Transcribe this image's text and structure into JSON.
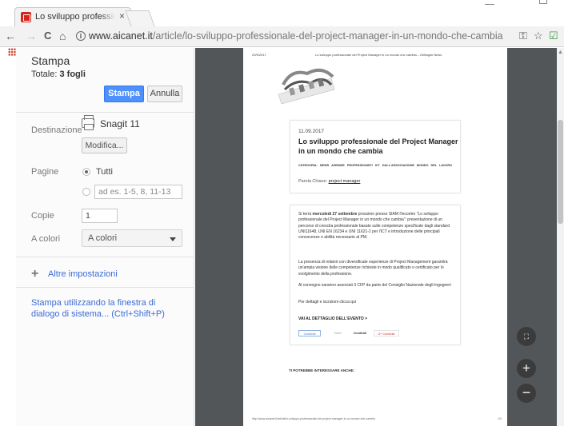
{
  "browser": {
    "tab_title": "Lo sviluppo professionale",
    "tab_close": "×",
    "url_host": "www.aicanet.it",
    "url_path": "/article/lo-sviluppo-professionale-del-project-manager-in-un-mondo-che-cambia",
    "nav_back": "←",
    "nav_forward": "→",
    "nav_reload": "C",
    "nav_home": "⌂",
    "info_glyph": "i",
    "star_glyph": "☆",
    "ext_glyph": "☑",
    "key_glyph": "⚿"
  },
  "print_panel": {
    "title": "Stampa",
    "total_label": "Totale:",
    "total_value": "3 fogli",
    "print_button": "Stampa",
    "cancel_button": "Annulla",
    "destination_label": "Destinazione",
    "destination_name": "Snagit 11",
    "modify_button": "Modifica...",
    "pages_label": "Pagine",
    "pages_all": "Tutti",
    "pages_custom_placeholder": "ad es. 1-5, 8, 11-13",
    "copies_label": "Copie",
    "copies_value": "1",
    "color_label": "A colori",
    "color_value": "A colori",
    "more_settings_icon": "+",
    "more_settings": "Altre impostazioni",
    "system_dialog": "Stampa utilizzando la finestra di dialogo di sistema... (Ctrl+Shift+P)"
  },
  "preview_page": {
    "header_date": "29/9/2017",
    "header_title": "Lo sviluppo professionale del Project Manager in un mondo che cambia – Dettaglio News",
    "article_date": "11.09.2017",
    "article_title": "Lo sviluppo professionale del Project Manager in un mondo che cambia",
    "categories": "CATEGORIA:  NEWS   AZIENDE   PROFESSIONISTI ICT   DALL'ASSOCIAZIONE   MONDO DEL LAVORO",
    "keyword_label": "Parola Chiave:",
    "keyword_value": "project manager",
    "para1_bold": "mercoledì 27 settembre",
    "para1_pre": "Si terrà",
    "para1_post": "prossimo presso SIAM l'incontro \"Lo sviluppo professionale del Project Manager in un mondo che cambia\": presentazione di un percorso di crescita professionale basato sulle competenze specificate dagli standard UNI11648, UNI EN 16234 e UNI 11621-2 per l'ICT e introduzione delle principali conoscenze e abilità necessarie al PM.",
    "para2": "La presenza di relatori con diversificate esperienze di Project Management garantirà un'ampia visione delle competenze richieste in modo qualificato o certificato per lo svolgimento della professione.",
    "para3": "Al convegno saranno associati 3 CFP da parte del Consiglio Nazionale degli Ingegneri",
    "para4": "Per dettagli e iscrizioni clicca qui",
    "event_link": "VAI AL DETTAGLIO DELL'EVENTO >",
    "share_1": "Condividi",
    "share_2": "Tweet",
    "share_3": "Condividi",
    "share_4": "G+ Condividi",
    "also_interested": "TI POTREBBE INTERESSARE ANCHE:",
    "footer_url": "http://www.aicanet.it/article/lo-sviluppo-professionale-del-project-manager-in-un-mondo-che-cambia",
    "footer_page": "1/3"
  },
  "zoom_controls": {
    "fit_glyph": "⛶",
    "zoom_in": "+",
    "zoom_out": "−"
  },
  "colors": {
    "accent_blue": "#4d90fe",
    "link_blue": "#3b6bd6",
    "preview_bg": "#525659",
    "favicon_red": "#d6251c"
  }
}
